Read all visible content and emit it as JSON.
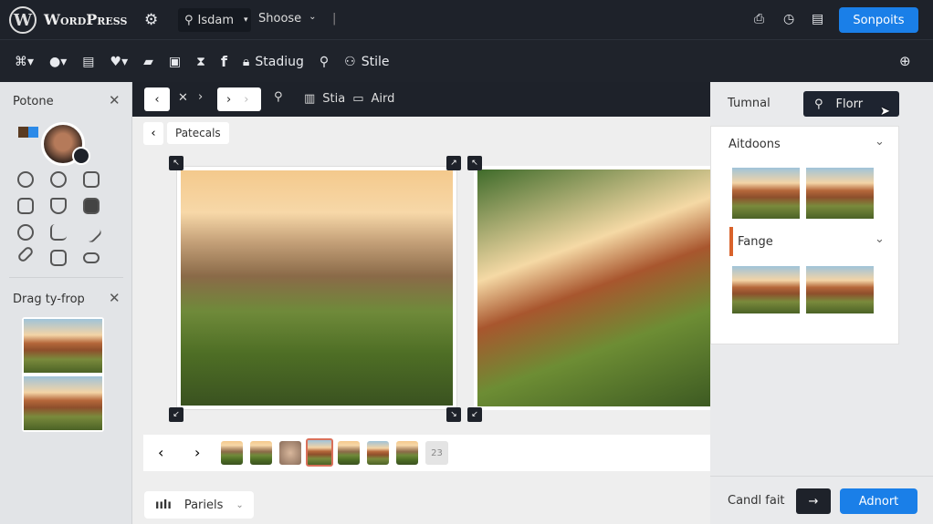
{
  "topbar": {
    "brand": "WordPress",
    "search_label": "Isdam",
    "choose_label": "Shoose",
    "separator": "|",
    "primary_button": "Sonpoits"
  },
  "toolbar": {
    "icons": [
      "apps-icon",
      "apple-icon",
      "list-icon",
      "twitter-icon",
      "folder-icon",
      "bookmark-icon",
      "hourglass-icon",
      "facebook-icon"
    ],
    "lock_label": "Stadiug",
    "style_label": "Stile"
  },
  "left_panel": {
    "title": "Potone",
    "dragdrop_title": "Drag ty-frop"
  },
  "editor_toolbar": {
    "stia_label": "Stia",
    "aird_label": "Aird"
  },
  "breadcrumb": {
    "label": "Patecals"
  },
  "filmstrip": {
    "more_count": "23",
    "selected_index": 3
  },
  "panels_button": {
    "label": "Pariels"
  },
  "right_panel": {
    "tab_label": "Tumnal",
    "filter_button": "Florr",
    "section1": "Aitdoons",
    "section2": "Fange",
    "accent": "#d9622b"
  },
  "footer": {
    "status": "Candl fait",
    "primary": "Adnort"
  },
  "colors": {
    "primary": "#1a7fe8",
    "dark": "#1e222a"
  }
}
